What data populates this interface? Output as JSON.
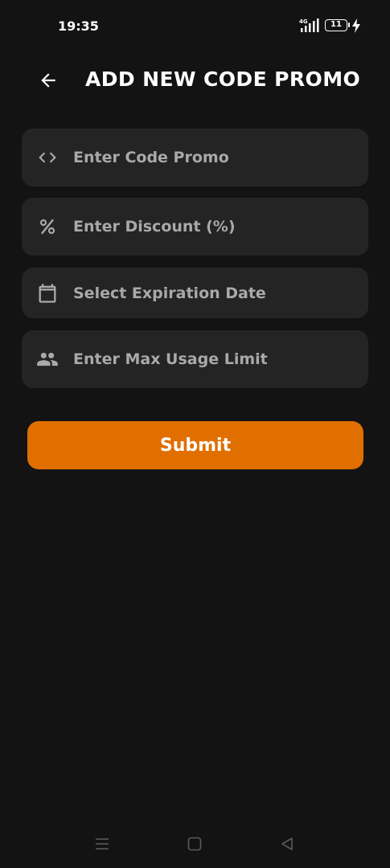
{
  "status_bar": {
    "time": "19:35",
    "network": "4G",
    "battery": "11",
    "charging": true
  },
  "header": {
    "title": "ADD NEW CODE PROMO",
    "back_icon": "arrow-left-icon"
  },
  "form": {
    "code_promo": {
      "placeholder": "Enter Code Promo",
      "value": "",
      "icon": "code-brackets-icon"
    },
    "discount": {
      "placeholder": "Enter Discount (%)",
      "value": "",
      "icon": "percent-icon"
    },
    "expiration_date": {
      "label": "Select Expiration Date",
      "icon": "calendar-icon"
    },
    "max_usage": {
      "placeholder": "Enter Max Usage Limit",
      "value": "",
      "icon": "people-icon"
    }
  },
  "submit": {
    "label": "Submit"
  },
  "nav_bar": {
    "menu_icon": "menu-icon",
    "home_icon": "square-home-icon",
    "back_icon": "triangle-back-icon"
  },
  "colors": {
    "background": "#131313",
    "field_background": "#242424",
    "placeholder": "#a9a9a9",
    "accent": "#e06f00",
    "text": "#ffffff"
  }
}
